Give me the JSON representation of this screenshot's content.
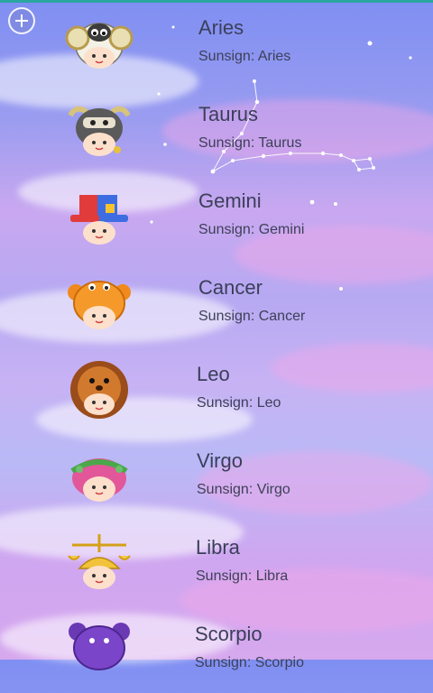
{
  "toolbar": {
    "add_icon": "plus-circle-icon"
  },
  "signs": [
    {
      "name": "Aries",
      "sunsign": "Sunsign: Aries"
    },
    {
      "name": "Taurus",
      "sunsign": "Sunsign: Taurus"
    },
    {
      "name": "Gemini",
      "sunsign": "Sunsign: Gemini"
    },
    {
      "name": "Cancer",
      "sunsign": "Sunsign: Cancer"
    },
    {
      "name": "Leo",
      "sunsign": "Sunsign: Leo"
    },
    {
      "name": "Virgo",
      "sunsign": "Sunsign: Virgo"
    },
    {
      "name": "Libra",
      "sunsign": "Sunsign: Libra"
    },
    {
      "name": "Scorpio",
      "sunsign": "Sunsign: Scorpio"
    }
  ],
  "colors": {
    "accent_top": "#2aa6a0",
    "text": "#3b3f5a"
  }
}
